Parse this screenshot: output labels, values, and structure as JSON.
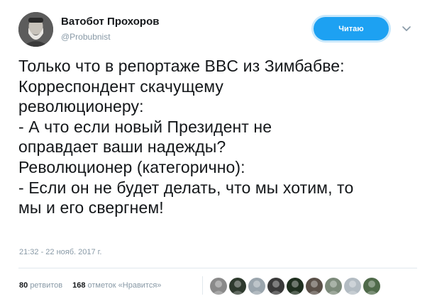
{
  "user": {
    "name": "Ватобот Прохоров",
    "handle": "@Probubnist"
  },
  "follow_button": {
    "label": "Читаю"
  },
  "tweet": {
    "lines": [
      "Только что в репортаже BBC из Зимбабве:",
      "Корреспондент скачущему",
      "революционеру:",
      "- А что если новый Президент не",
      "оправдает ваши надежды?",
      "Революционер (категорично):",
      "- Если он не будет делать, что мы хотим, то",
      "мы и его свергнем!"
    ],
    "timestamp": "21:32 - 22 нояб. 2017 г."
  },
  "stats": {
    "retweets_count": "80",
    "retweets_label": "ретвитов",
    "likes_count": "168",
    "likes_label": "отметок «Нравится»"
  },
  "likers": [
    {
      "name": "liker-avatar-1",
      "color": "#8a8a8a"
    },
    {
      "name": "liker-avatar-2",
      "color": "#2e3a2e"
    },
    {
      "name": "liker-avatar-3",
      "color": "#9aa5ad"
    },
    {
      "name": "liker-avatar-4",
      "color": "#3a3a3a"
    },
    {
      "name": "liker-avatar-5",
      "color": "#1f2f1f"
    },
    {
      "name": "liker-avatar-6",
      "color": "#5a5048"
    },
    {
      "name": "liker-avatar-7",
      "color": "#7c8a7a"
    },
    {
      "name": "liker-avatar-8",
      "color": "#b3bcc3"
    },
    {
      "name": "liker-avatar-9",
      "color": "#4f6a4a"
    }
  ],
  "colors": {
    "accent": "#1da1f2",
    "secondary_text": "#8899a6",
    "primary_text": "#14171a"
  }
}
